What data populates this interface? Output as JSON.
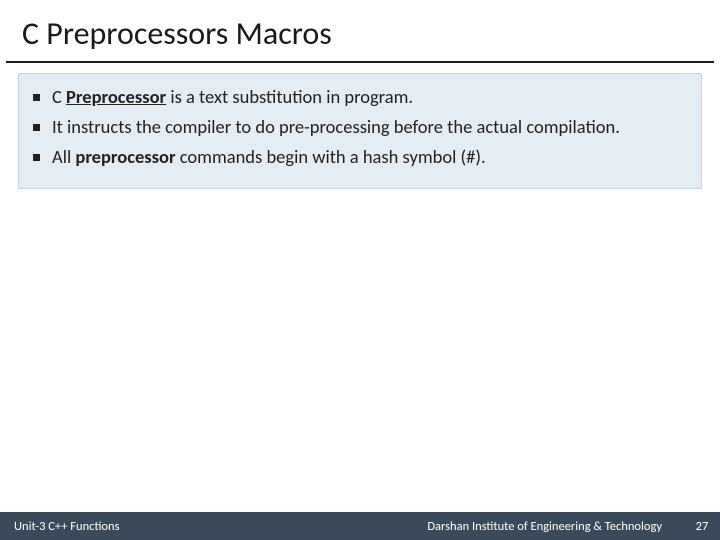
{
  "slide": {
    "title": "C Preprocessors Macros",
    "bullets": [
      {
        "prefix": "C ",
        "emphasis": "Preprocessor",
        "suffix": " is a text substitution in program.",
        "emphasis_underline": true,
        "justify": false
      },
      {
        "prefix": "It instructs the compiler to do pre-processing before the actual compilation.",
        "emphasis": "",
        "suffix": "",
        "emphasis_underline": false,
        "justify": true
      },
      {
        "prefix": "All ",
        "emphasis": "preprocessor",
        "suffix": " commands begin with a hash symbol (#).",
        "emphasis_underline": false,
        "justify": false
      }
    ]
  },
  "footer": {
    "left": "Unit-3 C++ Functions",
    "center": "Darshan Institute of Engineering & Technology",
    "page": "27"
  }
}
